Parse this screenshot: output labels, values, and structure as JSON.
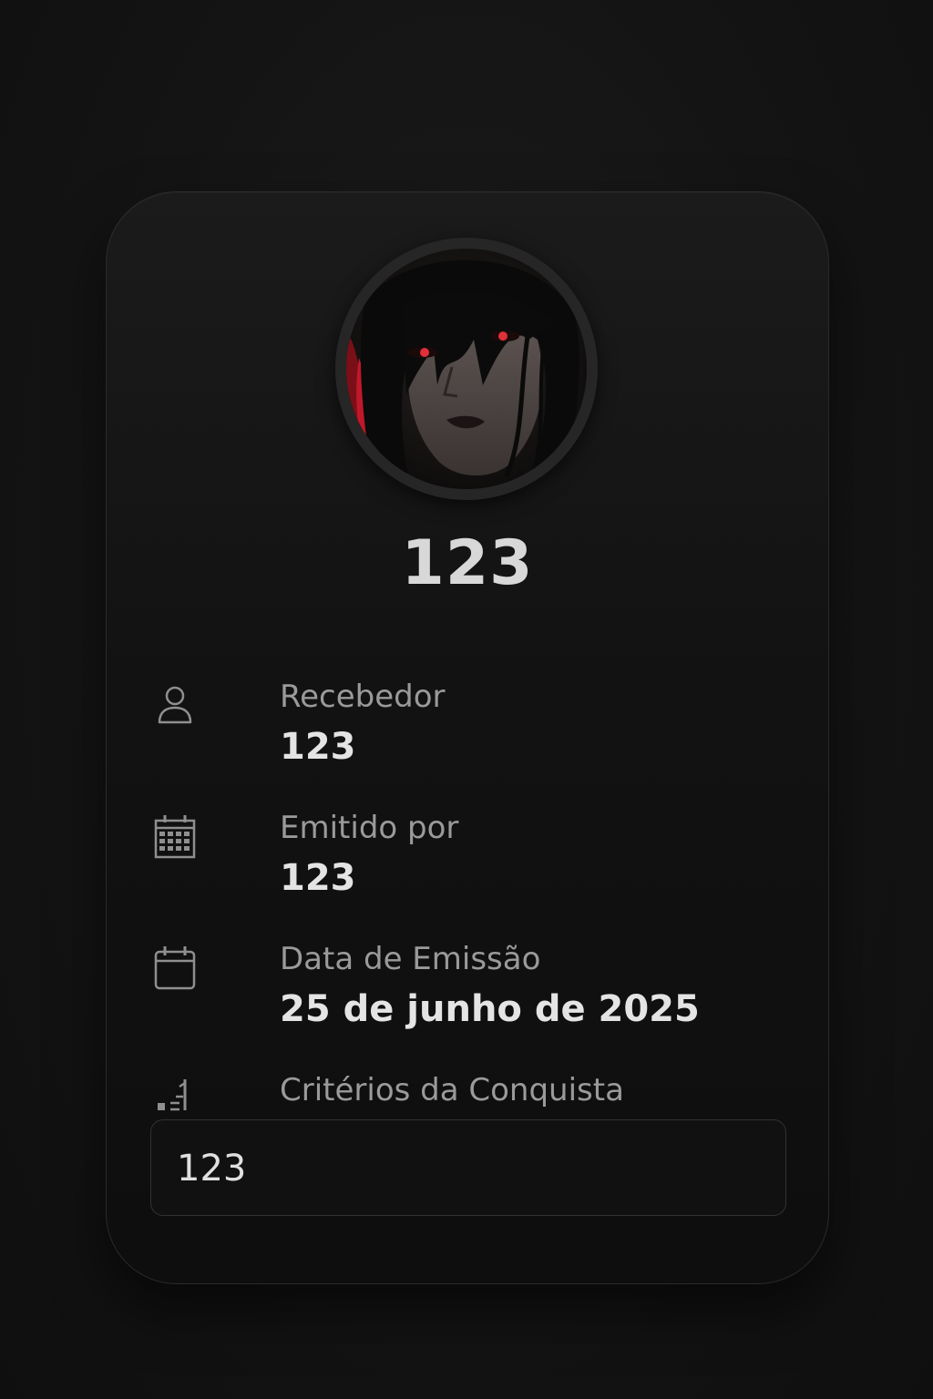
{
  "card": {
    "title": "123",
    "avatar_alt": "avatar portrait",
    "fields": [
      {
        "icon": "user-icon",
        "label": "Recebedor",
        "value": "123"
      },
      {
        "icon": "building-icon",
        "label": "Emitido por",
        "value": "123"
      },
      {
        "icon": "calendar-icon",
        "label": "Data de Emissão",
        "value": "25 de junho de 2025"
      }
    ],
    "criteria": {
      "icon": "criteria-icon",
      "label": "Critérios da Conquista",
      "value": "123"
    }
  },
  "colors": {
    "background": "#141414",
    "card": "#121212",
    "accent_red": "#c0182a",
    "text_primary": "#e4e4e4",
    "text_secondary": "#9a9a9a"
  }
}
